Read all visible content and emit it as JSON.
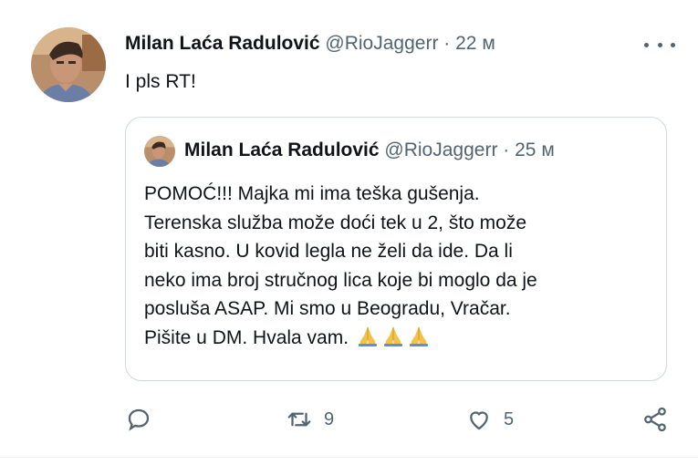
{
  "tweet": {
    "author_name": "Milan Laća Radulović",
    "handle": "@RioJaggerr",
    "separator": "·",
    "time": "22 м",
    "text": "I pls RT!"
  },
  "quoted_tweet": {
    "author_name": "Milan Laća Radulović",
    "handle": "@RioJaggerr",
    "separator": "·",
    "time": "25 м",
    "lines": [
      "POMOĆ!!! Majka mi ima teška gušenja.",
      "Terenska služba može doći tek u 2, što može",
      "biti kasno. U kovid legla ne želi da ide. Da li",
      "neko ima broj stručnog lica koje bi moglo da je",
      "posluša ASAP. Mi smo u Beogradu, Vračar.",
      "Pišite u DM. Hvala vam."
    ],
    "emoji": [
      "folded-hands",
      "folded-hands",
      "folded-hands"
    ]
  },
  "actions": {
    "reply_icon": "reply-icon",
    "retweet_icon": "retweet-icon",
    "retweet_count": "9",
    "like_icon": "heart-icon",
    "like_count": "5",
    "share_icon": "share-icon"
  },
  "colors": {
    "text": "#0f1419",
    "muted": "#536471",
    "border": "#cfd9de",
    "emoji": "#f4c24a"
  }
}
